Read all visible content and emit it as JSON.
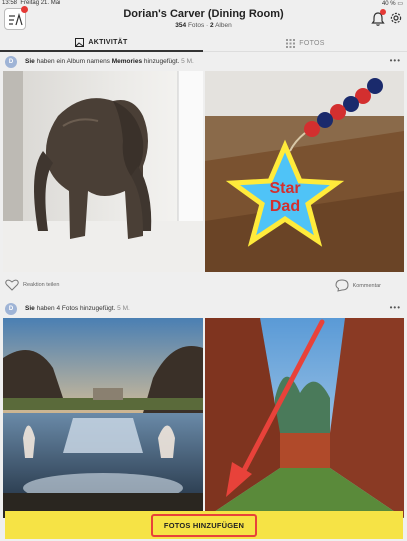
{
  "status_bar": {
    "time": "13:58",
    "date": "Freitag 21. Mai",
    "battery": "40 %"
  },
  "header": {
    "title": "Dorian's Carver (Dining Room)",
    "photo_count": "354",
    "photos_word": "Fotos",
    "separator": "·",
    "album_count": "2",
    "albums_word": "Alben"
  },
  "tabs": [
    {
      "label": "AKTIVITÄT",
      "icon": "image-frame-icon",
      "active": true
    },
    {
      "label": "FOTOS",
      "icon": "grid-icon",
      "active": false
    }
  ],
  "posts": [
    {
      "avatar": "D",
      "actor": "Sie",
      "text_before": "haben ein Album namens",
      "album": "Memories",
      "text_after": "hinzugefügt.",
      "ago": "5 M.",
      "photos": [
        "wooden-elephant-photo",
        "star-dad-keychain-photo"
      ],
      "react_label": "Reaktion teilen",
      "comment_label": "Kommentar"
    },
    {
      "avatar": "D",
      "actor": "Sie",
      "text_before": "haben 4 Fotos hinzugefügt.",
      "ago": "5 M.",
      "photos": [
        "fountain-park-photo",
        "hedge-maze-photo"
      ]
    }
  ],
  "add_button": {
    "label": "FOTOS HINZUFÜGEN"
  },
  "colors": {
    "accent_yellow": "#f6e345",
    "annotation_red": "#e8423a",
    "badge_red": "#e53935"
  }
}
